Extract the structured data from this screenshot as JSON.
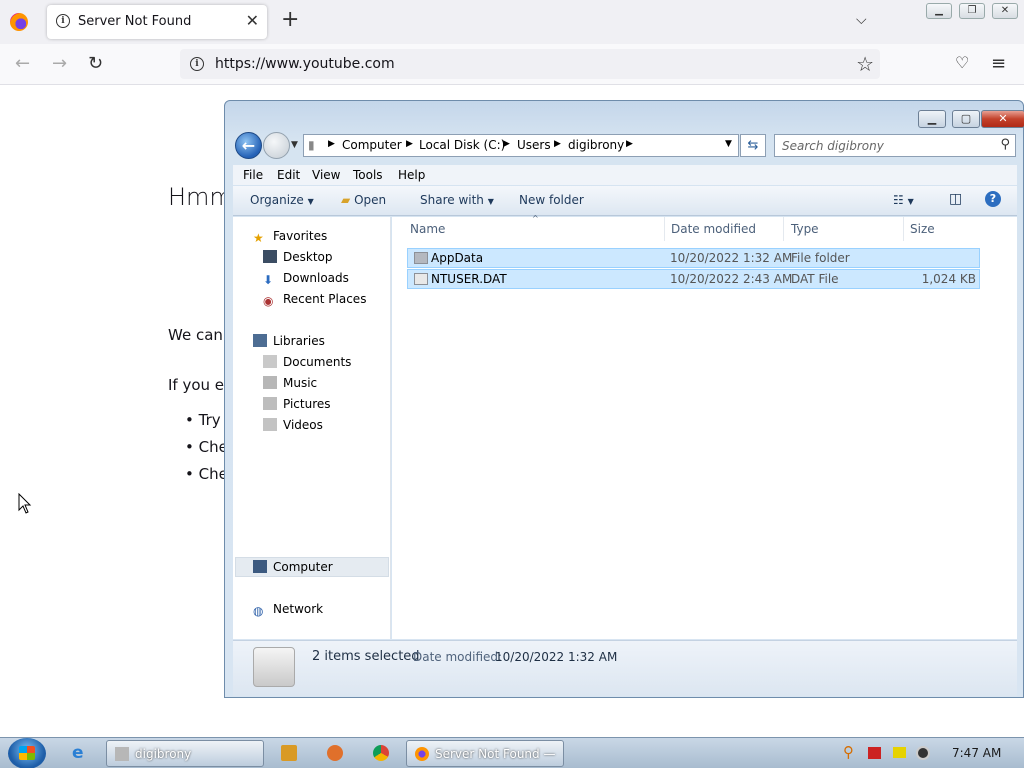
{
  "browser": {
    "tab_title": "Server Not Found",
    "url": "https://www.youtube.com",
    "page": {
      "heading": "Hmm",
      "line1": "We can",
      "line2": "If you er",
      "bullets": [
        "Try",
        "Che",
        "Che"
      ]
    }
  },
  "explorer": {
    "breadcrumb": [
      "Computer",
      "Local Disk (C:)",
      "Users",
      "digibrony"
    ],
    "search_placeholder": "Search digibrony",
    "menu": [
      "File",
      "Edit",
      "View",
      "Tools",
      "Help"
    ],
    "commands": {
      "organize": "Organize",
      "open": "Open",
      "share": "Share with",
      "new_folder": "New folder"
    },
    "nav": {
      "favorites": "Favorites",
      "desktop": "Desktop",
      "downloads": "Downloads",
      "recent": "Recent Places",
      "libraries": "Libraries",
      "documents": "Documents",
      "music": "Music",
      "pictures": "Pictures",
      "videos": "Videos",
      "computer": "Computer",
      "network": "Network"
    },
    "columns": {
      "name": "Name",
      "date": "Date modified",
      "type": "Type",
      "size": "Size"
    },
    "files": [
      {
        "name": "AppData",
        "date": "10/20/2022 1:32 AM",
        "type": "File folder",
        "size": ""
      },
      {
        "name": "NTUSER.DAT",
        "date": "10/20/2022 2:43 AM",
        "type": "DAT File",
        "size": "1,024 KB"
      }
    ],
    "details": {
      "selected": "2 items selected",
      "date_label": "Date modified:",
      "date_value": "10/20/2022 1:32 AM"
    }
  },
  "taskbar": {
    "explorer_label": "digibrony",
    "firefox_label": "Server Not Found — ...",
    "time": "7:47 AM"
  },
  "colors": {
    "selection": "#cce8ff",
    "selection_border": "#99d1ff",
    "window_frame": "#c4d6ea"
  }
}
